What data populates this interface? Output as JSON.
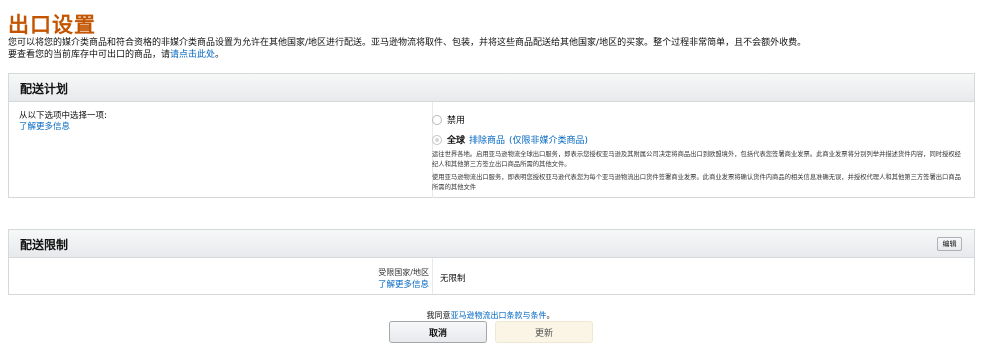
{
  "page": {
    "title": "出口设置",
    "intro_line1": "您可以将您的媒介类商品和符合资格的非媒介类商品设置为允许在其他国家/地区进行配送。亚马逊物流将取件、包装，并将这些商品配送给其他国家/地区的买家。整个过程非常简单，且不会额外收费。",
    "intro_line2_prefix": "要查看您的当前库存中可出口的商品，请",
    "intro_line2_link": "请点击此处",
    "intro_line2_suffix": "。"
  },
  "shipping_plan": {
    "title": "配送计划",
    "choose_text": "从以下选项中选择一项:",
    "learn_more": "了解更多信息",
    "options": [
      {
        "label": "禁用",
        "checked": false
      },
      {
        "label": "全球",
        "link1": "排除商品",
        "link2": "(仅限非媒介类商品)",
        "checked": true
      }
    ],
    "desc1": "运往世界各地。启用亚马逊物流全球出口服务，即表示您授权亚马逊及其附属公司决定将商品出口到欧盟境外，包括代表您签署商业发票。此商业发票将分别列举并描述货件内容，同时授权经纪人和其他第三方签立出口商品所需的其他文件。",
    "desc2": "使用亚马逊物流出口服务，即表明您授权亚马逊代表您为每个亚马逊物流出口货件签署商业发票。此商业发票将确认货件内商品的相关信息准确无误，并授权代理人和其他第三方签署出口商品所需的其他文件"
  },
  "shipping_restriction": {
    "title": "配送限制",
    "edit_label": "编辑",
    "label": "受限国家/地区",
    "learn_more": "了解更多信息",
    "value": "无限制"
  },
  "footer": {
    "agree_prefix": "我同意",
    "agree_link": "亚马逊物流出口条款与条件",
    "agree_suffix": "。",
    "cancel_label": "取消",
    "update_label": "更新"
  },
  "colors": {
    "title": "#c45500",
    "link": "#0066c0",
    "update_bg": "#fbf5e6"
  }
}
